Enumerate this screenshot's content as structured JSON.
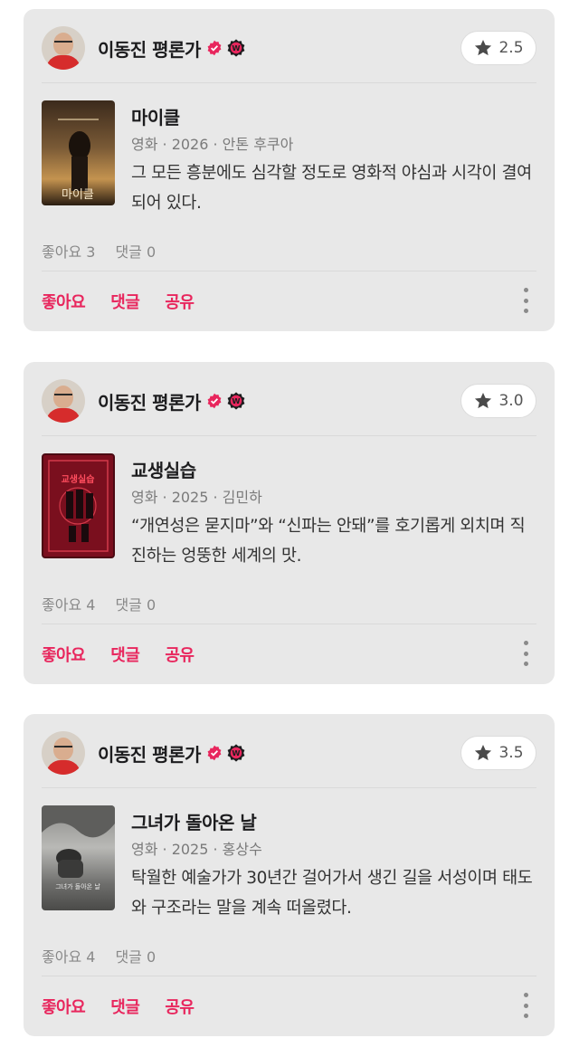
{
  "reviews": [
    {
      "critic": "이동진 평론가",
      "rating": "2.5",
      "movie": {
        "title": "마이클",
        "meta": "영화 · 2026 · 안톤 후쿠아",
        "poster_text": "마이클"
      },
      "review": "그 모든 흥분에도 심각할 정도로 영화적 야심과 시각이 결여되어 있다.",
      "likes": "좋아요 3",
      "comments": "댓글 0"
    },
    {
      "critic": "이동진 평론가",
      "rating": "3.0",
      "movie": {
        "title": "교생실습",
        "meta": "영화 · 2025 · 김민하",
        "poster_text": "교생실습"
      },
      "review": "“개연성은 묻지마”와 “신파는 안돼”를 호기롭게 외치며 직진하는 엉뚱한 세계의 맛.",
      "likes": "좋아요 4",
      "comments": "댓글 0"
    },
    {
      "critic": "이동진 평론가",
      "rating": "3.5",
      "movie": {
        "title": "그녀가 돌아온 날",
        "meta": "영화 · 2025 · 홍상수",
        "poster_text": "그녀가 돌아온 날"
      },
      "review": "탁월한 예술가가 30년간 걸어가서 생긴 길을 서성이며 태도와 구조라는 말을 계속 떠올렸다.",
      "likes": "좋아요 4",
      "comments": "댓글 0"
    }
  ],
  "actions": {
    "like": "좋아요",
    "comment": "댓글",
    "share": "공유"
  },
  "colors": {
    "accent": "#e8265d",
    "card_bg": "#e8e8e8",
    "star": "#4a4a4a"
  },
  "icons": {
    "verified": "verified-check-icon",
    "badge": "w-badge-icon",
    "star": "star-icon",
    "more": "more-vertical-icon"
  }
}
